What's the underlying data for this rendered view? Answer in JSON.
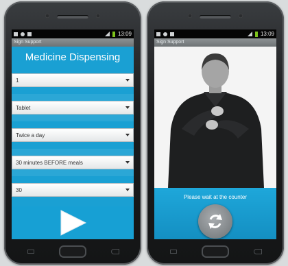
{
  "left_phone": {
    "status": {
      "time": "13:09"
    },
    "titlebar": "Sign Support",
    "heading": "Medicine Dispensing",
    "dropdowns": [
      {
        "value": "1"
      },
      {
        "value": "Tablet"
      },
      {
        "value": "Twice a day"
      },
      {
        "value": "30 minutes BEFORE meals"
      },
      {
        "value": "30"
      }
    ],
    "play_icon": "play-icon"
  },
  "right_phone": {
    "status": {
      "time": "13:09"
    },
    "titlebar": "Sign Support",
    "message": "Please wait at the counter",
    "refresh_icon": "refresh-icon"
  }
}
